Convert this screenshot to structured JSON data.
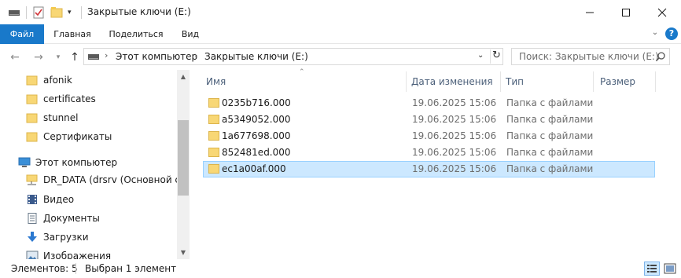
{
  "window": {
    "title": "Закрытые ключи (E:)"
  },
  "ribbon": {
    "tabs": [
      "Файл",
      "Главная",
      "Поделиться",
      "Вид"
    ],
    "accent": "#1979ca"
  },
  "navigation": {
    "breadcrumb": [
      "Этот компьютер",
      "Закрытые ключи (E:)"
    ],
    "search_placeholder": "Поиск: Закрытые ключи (E:)"
  },
  "sidebar": {
    "items": [
      {
        "label": "afonik",
        "icon": "folder-icon"
      },
      {
        "label": "certificates",
        "icon": "folder-icon"
      },
      {
        "label": "stunnel",
        "icon": "folder-icon"
      },
      {
        "label": "Сертификаты",
        "icon": "folder-icon"
      },
      {
        "label": "Этот компьютер",
        "icon": "computer-icon"
      },
      {
        "label": "DR_DATA (drsrv (Основной серв",
        "icon": "network-drive-icon"
      },
      {
        "label": "Видео",
        "icon": "video-icon"
      },
      {
        "label": "Документы",
        "icon": "documents-icon"
      },
      {
        "label": "Загрузки",
        "icon": "downloads-icon"
      },
      {
        "label": "Изображения",
        "icon": "pictures-icon"
      }
    ]
  },
  "file_list": {
    "columns": [
      "Имя",
      "Дата изменения",
      "Тип",
      "Размер"
    ],
    "rows": [
      {
        "name": "0235b716.000",
        "date": "19.06.2025 15:06",
        "type": "Папка с файлами",
        "selected": false
      },
      {
        "name": "a5349052.000",
        "date": "19.06.2025 15:06",
        "type": "Папка с файлами",
        "selected": false
      },
      {
        "name": "1a677698.000",
        "date": "19.06.2025 15:06",
        "type": "Папка с файлами",
        "selected": false
      },
      {
        "name": "852481ed.000",
        "date": "19.06.2025 15:06",
        "type": "Папка с файлами",
        "selected": false
      },
      {
        "name": "ec1a00af.000",
        "date": "19.06.2025 15:06",
        "type": "Папка с файлами",
        "selected": true
      }
    ],
    "selection_color": "#cce8ff"
  },
  "status": {
    "count": "Элементов: 5",
    "selection": "Выбран 1 элемент"
  }
}
